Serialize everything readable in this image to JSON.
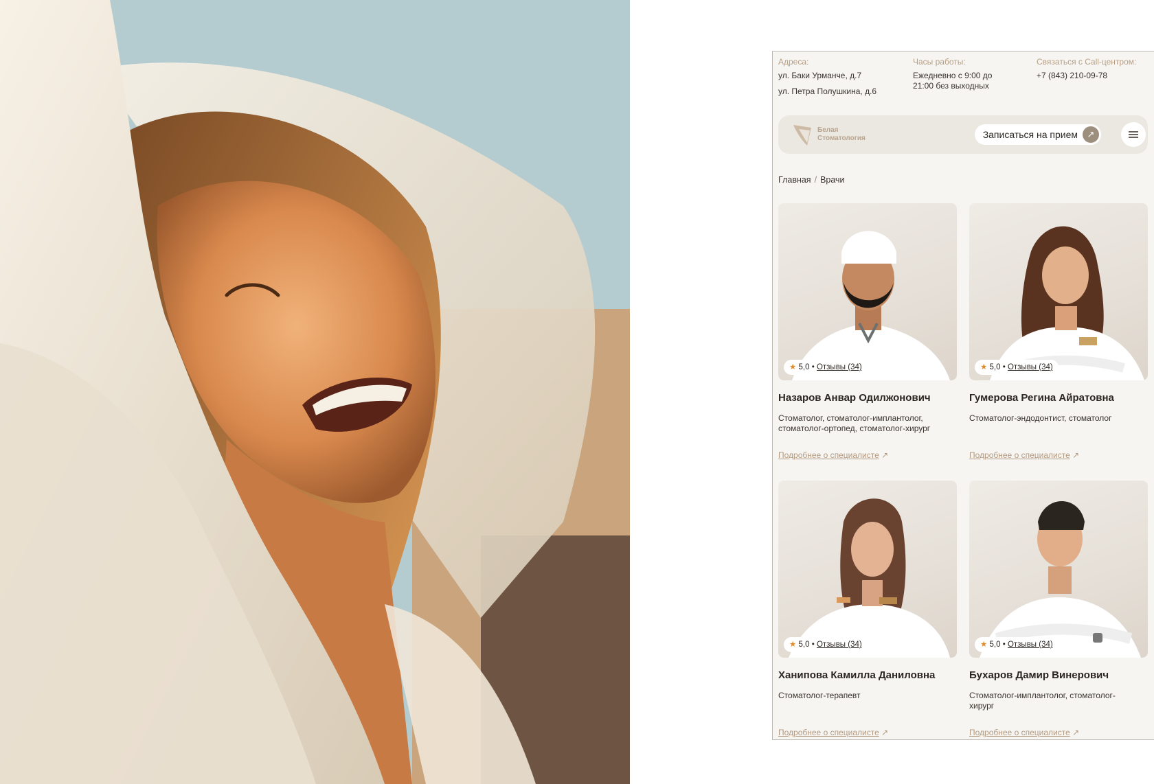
{
  "hero": {
    "image": "smiling-woman-photo"
  },
  "topinfo": {
    "addresses_label": "Адреса:",
    "addresses": [
      "ул. Баки Урманче, д.7",
      "ул. Петра Полушкина, д.6"
    ],
    "hours_label": "Часы работы:",
    "hours": [
      "Ежедневно с 9:00 до",
      "21:00 без выходных"
    ],
    "call_label": "Связаться с Call-центром:",
    "phone": "+7 (843) 210-09-78"
  },
  "navbar": {
    "logo_line1": "Белая",
    "logo_line2": "Стоматология",
    "cta_label": "Записаться на прием",
    "cta_icon": "arrow-up-right-icon",
    "menu_icon": "hamburger-menu-icon"
  },
  "breadcrumb": {
    "home": "Главная",
    "sep": "/",
    "current": "Врачи"
  },
  "colors": {
    "accent": "#b29a82",
    "star": "#e08c2c",
    "navbar_bg": "#ebe7e1",
    "page_bg": "#f6f5f1"
  },
  "doctors": [
    {
      "rating": "5,0",
      "reviews": "Отзывы (34)",
      "name": "Назаров Анвар Одилжонович",
      "spec_lines": [
        "Стоматолог, стоматолог-имплантолог,",
        "стоматолог-ортопед, стоматолог-хирург"
      ],
      "more": "Подробнее о специалисте",
      "more_icon": "↗"
    },
    {
      "rating": "5,0",
      "reviews": "Отзывы (34)",
      "name": "Гумерова Регина Айратовна",
      "spec_lines": [
        "Стоматолог-эндодонтист, стоматолог"
      ],
      "more": "Подробнее о специалисте",
      "more_icon": "↗"
    },
    {
      "rating": "5,0",
      "reviews": "Отзывы (34)",
      "name": "Ханипова Камилла Даниловна",
      "spec_lines": [
        "Стоматолог-терапевт"
      ],
      "more": "Подробнее о специалисте",
      "more_icon": "↗"
    },
    {
      "rating": "5,0",
      "reviews": "Отзывы (34)",
      "name": "Бухаров Дамир Винерович",
      "spec_lines": [
        "Стоматолог-имплантолог, стоматолог-",
        "хирург"
      ],
      "more": "Подробнее о специалисте",
      "more_icon": "↗"
    }
  ]
}
